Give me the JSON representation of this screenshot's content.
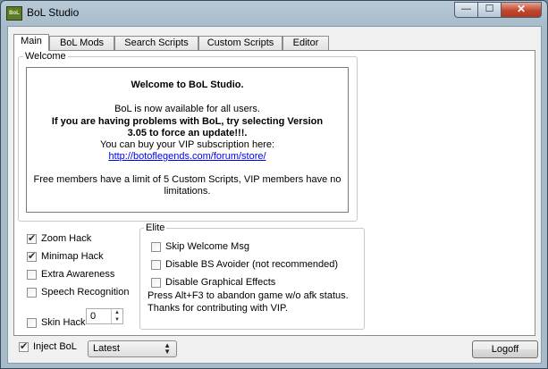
{
  "window": {
    "title": "BoL Studio",
    "icon_text": "BoL"
  },
  "titlebar_buttons": {
    "minimize": "—",
    "maximize": "☐",
    "close": "✕"
  },
  "tabs": [
    {
      "label": "Main",
      "active": true
    },
    {
      "label": "BoL Mods",
      "active": false
    },
    {
      "label": "Search Scripts",
      "active": false
    },
    {
      "label": "Custom Scripts",
      "active": false
    },
    {
      "label": "Editor",
      "active": false
    }
  ],
  "welcome": {
    "legend": "Welcome",
    "heading": "Welcome to BoL Studio.",
    "line1": "BoL is now available for all users.",
    "bold_line1": "If you are having problems with BoL, try selecting Version",
    "bold_line2": "3.05 to force an update!!!.",
    "line2": "You can buy your VIP subscription here:",
    "link": "http://botoflegends.com/forum/store/",
    "footer1": "Free members have a limit of 5 Custom Scripts, VIP members have no",
    "footer2": "limitations."
  },
  "options": [
    {
      "label": "Zoom Hack",
      "checked": true
    },
    {
      "label": "Minimap Hack",
      "checked": true
    },
    {
      "label": "Extra Awareness",
      "checked": false
    },
    {
      "label": "Speech Recognition",
      "checked": false
    }
  ],
  "skin_hack": {
    "label": "Skin Hack",
    "checked": false,
    "value": "0"
  },
  "elite": {
    "legend": "Elite",
    "options": [
      {
        "label": "Skip Welcome Msg",
        "checked": false
      },
      {
        "label": "Disable BS Avoider (not recommended)",
        "checked": false
      },
      {
        "label": "Disable Graphical Effects",
        "checked": false
      }
    ],
    "note1": "Press Alt+F3 to abandon game w/o afk status.",
    "note2": "Thanks for contributing with VIP."
  },
  "footer": {
    "inject_label": "Inject BoL",
    "inject_checked": true,
    "version_selected": "Latest",
    "logoff_label": "Logoff"
  }
}
